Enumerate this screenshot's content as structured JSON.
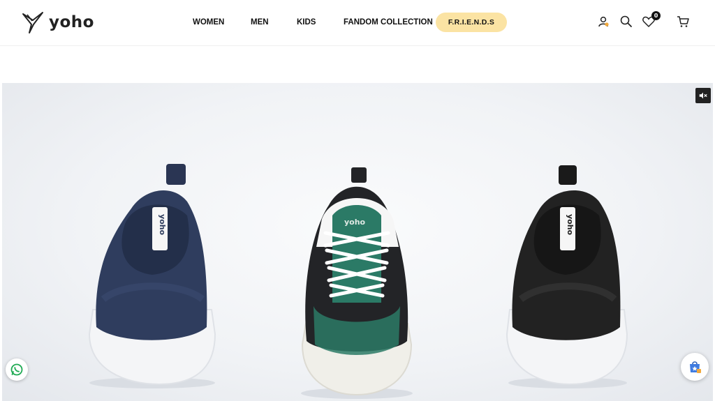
{
  "brand": {
    "name": "yoho",
    "logo_icon": "yoho-bird-logo"
  },
  "nav": {
    "items": [
      {
        "label": "WOMEN"
      },
      {
        "label": "MEN"
      },
      {
        "label": "KIDS"
      },
      {
        "label": "FANDOM COLLECTION"
      }
    ],
    "highlight": {
      "label": "F.R.I.E.N.D.S",
      "color": "#fbe3a3"
    }
  },
  "header_icons": {
    "account": "user-icon",
    "search": "search-icon",
    "wishlist": "heart-icon",
    "wishlist_count": "0",
    "cart": "cart-icon"
  },
  "hero": {
    "mute_icon": "volume-mute-icon",
    "shoes": [
      {
        "name": "navy-slip-on-sneaker",
        "color": "#2f3d5e",
        "tag_text": "yoho"
      },
      {
        "name": "black-green-lace-up-sneaker",
        "color": "#2b7a66",
        "tag_text": "yoho"
      },
      {
        "name": "black-slip-on-sneaker",
        "color": "#222222",
        "tag_text": "yoho"
      }
    ]
  },
  "floating": {
    "whatsapp_icon": "whatsapp-icon",
    "shop_icon": "shopping-bag-icon"
  }
}
